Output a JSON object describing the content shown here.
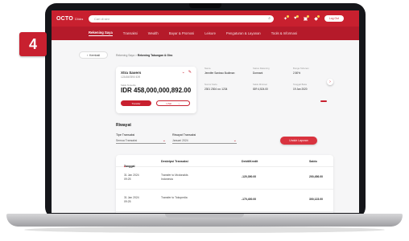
{
  "step_number": "4",
  "app": {
    "logo": "OCTO",
    "logo_sub": "Clicks",
    "search_placeholder": "Cari di sini",
    "logout_label": "Log Out"
  },
  "nav": {
    "items": [
      {
        "label": "Rekening Saya",
        "active": true
      },
      {
        "label": "Transaksi",
        "active": false
      },
      {
        "label": "Wealth",
        "active": false
      },
      {
        "label": "Bayar & Promosi",
        "active": false
      },
      {
        "label": "Leisure",
        "active": false
      },
      {
        "label": "Pengaturan & Layanan",
        "active": false
      },
      {
        "label": "Tools & Informasi",
        "active": false
      }
    ]
  },
  "breadcrumb": {
    "back_label": "Kembali",
    "root": "Rekening Saya",
    "separator": ">",
    "current": "Rekening Tabungan & Giro"
  },
  "account": {
    "name": "Xtra Savers",
    "number": "1234567890 IDR",
    "balance_label": "Saldo Tersedia",
    "balance": "IDR 458,000,000,892.00",
    "primary_button": "Transfer",
    "secondary_button": "Lihat"
  },
  "details": [
    {
      "key": "Nama",
      "value": "Jennifer Santoso Budiman"
    },
    {
      "key": "Status Rekening",
      "value": "Dormant"
    },
    {
      "key": "Bunga Tahunan",
      "value": "2.50%"
    },
    {
      "key": "Nomor Kartu",
      "value": "2301 2304 •••• 1234"
    },
    {
      "key": "Saldo Minimal",
      "value": "IDR 4,524.00"
    },
    {
      "key": "Tanggal Buka",
      "value": "19 Jan 2020"
    }
  ],
  "history": {
    "title": "Riwayat",
    "filter_type_label": "Tipe Transaksi",
    "filter_type_value": "Semua Transaksi",
    "filter_period_label": "Riwayat Transaksi",
    "filter_period_value": "Januari 2024",
    "download_label": "Unduh Laporan"
  },
  "table": {
    "headers": [
      "Tanggal",
      "Deskripsi Transaksi",
      "Debit/Kredit",
      "Saldo"
    ],
    "rows": [
      {
        "date": "31 Jan 2024",
        "time": "09:25",
        "desc_line1": "Transfer to Mcdonalds",
        "desc_line2": "Indonesia",
        "amount": "-120,390.00",
        "balance": "200,456.00"
      },
      {
        "date": "31 Jan 2024",
        "time": "09:25",
        "desc_line1": "Transfer to Tokopedia",
        "desc_line2": "",
        "amount": "-170,400.00",
        "balance": "300,123.00"
      }
    ]
  },
  "colors": {
    "brand_red": "#c8202f",
    "nav_red": "#b51a2a"
  }
}
